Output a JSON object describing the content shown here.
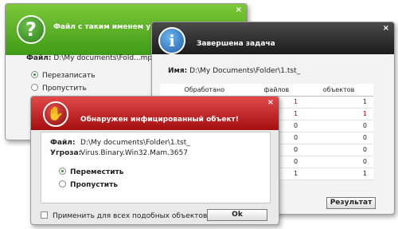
{
  "green_dialog": {
    "title": "Файл с таким именем у",
    "file_label": "Файл:",
    "file_value": "D:\\My documents\\Fold...mpl",
    "options": [
      "Перезаписать",
      "Пропустить"
    ],
    "selected_option": "Перезаписать"
  },
  "blue_dialog": {
    "title": "Завершена задача",
    "name_label": "Имя:",
    "name_value": "D:\\My Documents\\Folder\\1.tst_",
    "columns": [
      "Обработано",
      "файлов",
      "объектов"
    ],
    "rows": [
      [
        "",
        "1",
        "1"
      ],
      [
        "",
        "1",
        "1"
      ],
      [
        "",
        "0",
        "0"
      ],
      [
        "",
        "0",
        "0"
      ],
      [
        "",
        "0",
        "0"
      ],
      [
        "",
        "0",
        "0"
      ],
      [
        "",
        "1",
        "1"
      ]
    ],
    "result_button": "Результат"
  },
  "red_dialog": {
    "title": "Обнаружен инфицированный объект!",
    "file_label": "Файл:",
    "file_value": "D:\\My documents\\Folder\\1.tst_",
    "threat_label": "Угроза:",
    "threat_value": "Virus.Binary.Win32.Mam.3657",
    "options": [
      "Переместить",
      "Пропустить"
    ],
    "selected_option": "Переместить",
    "apply_all_label": "Применить для всех подобных объектов",
    "ok_button": "Ok"
  },
  "icons": {
    "close": "×",
    "question": "?",
    "info": "i",
    "hand": "✋"
  },
  "colors": {
    "green_header": "#3f9b16",
    "dark_header": "#1c1c1c",
    "red_header": "#a30e0e",
    "red_text": "#c00000"
  }
}
